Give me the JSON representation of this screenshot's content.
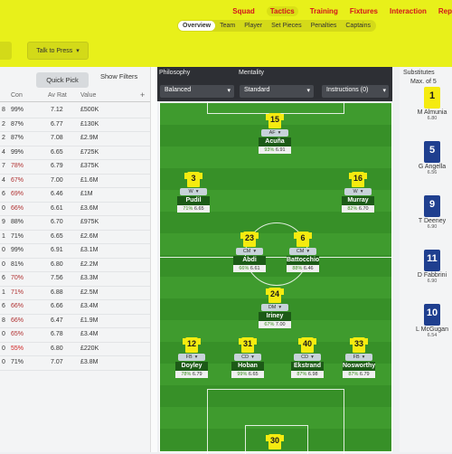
{
  "nav": [
    "Squad",
    "Tactics",
    "Training",
    "Fixtures",
    "Interaction",
    "Rep"
  ],
  "subnav": [
    "Overview",
    "Team",
    "Player",
    "Set Pieces",
    "Penalties",
    "Captains"
  ],
  "talk_button": "Talk to Press",
  "quick_pick": "Quick Pick",
  "show_filters": "Show Filters",
  "table": {
    "headers": {
      "con": "Con",
      "av_rat": "Av Rat",
      "value": "Value",
      "add": "+"
    },
    "rows": [
      {
        "n": "8",
        "con": "99%",
        "rat": "7.12",
        "val": "£500K",
        "con_color": "#333"
      },
      {
        "n": "2",
        "con": "87%",
        "rat": "6.77",
        "val": "£130K",
        "con_color": "#333"
      },
      {
        "n": "2",
        "con": "87%",
        "rat": "7.08",
        "val": "£2.9M",
        "con_color": "#333"
      },
      {
        "n": "4",
        "con": "99%",
        "rat": "6.65",
        "val": "£725K",
        "con_color": "#333"
      },
      {
        "n": "7",
        "con": "78%",
        "rat": "6.79",
        "val": "£375K",
        "con_color": "#b03030"
      },
      {
        "n": "4",
        "con": "67%",
        "rat": "7.00",
        "val": "£1.6M",
        "con_color": "#b03030"
      },
      {
        "n": "6",
        "con": "69%",
        "rat": "6.46",
        "val": "£1M",
        "con_color": "#b03030"
      },
      {
        "n": "0",
        "con": "66%",
        "rat": "6.61",
        "val": "£3.6M",
        "con_color": "#b03030"
      },
      {
        "n": "9",
        "con": "88%",
        "rat": "6.70",
        "val": "£975K",
        "con_color": "#333"
      },
      {
        "n": "1",
        "con": "71%",
        "rat": "6.65",
        "val": "£2.6M",
        "con_color": "#333"
      },
      {
        "n": "0",
        "con": "99%",
        "rat": "6.91",
        "val": "£3.1M",
        "con_color": "#333"
      },
      {
        "n": "0",
        "con": "81%",
        "rat": "6.80",
        "val": "£2.2M",
        "con_color": "#333"
      },
      {
        "n": "6",
        "con": "70%",
        "rat": "7.56",
        "val": "£3.3M",
        "con_color": "#b03030"
      },
      {
        "n": "1",
        "con": "71%",
        "rat": "6.88",
        "val": "£2.5M",
        "con_color": "#b03030"
      },
      {
        "n": "6",
        "con": "66%",
        "rat": "6.66",
        "val": "£3.4M",
        "con_color": "#b03030"
      },
      {
        "n": "8",
        "con": "66%",
        "rat": "6.47",
        "val": "£1.9M",
        "con_color": "#b03030"
      },
      {
        "n": "0",
        "con": "65%",
        "rat": "6.78",
        "val": "£3.4M",
        "con_color": "#b03030"
      },
      {
        "n": "0",
        "con": "55%",
        "rat": "6.80",
        "val": "£220K",
        "con_color": "#d02020"
      },
      {
        "n": "0",
        "con": "71%",
        "rat": "7.07",
        "val": "£3.8M",
        "con_color": "#333"
      }
    ]
  },
  "tactics": {
    "philosophy_label": "Philosophy",
    "mentality_label": "Mentality",
    "philosophy_value": "Balanced",
    "mentality_value": "Standard",
    "instructions": "Instructions (0)"
  },
  "players": [
    {
      "num": "15",
      "pos": "AF",
      "name": "Acuña",
      "cond": "93%",
      "rat": "6.91"
    },
    {
      "num": "3",
      "pos": "W",
      "name": "Pudil",
      "cond": "71%",
      "rat": "6.65"
    },
    {
      "num": "16",
      "pos": "W",
      "name": "Murray",
      "cond": "82%",
      "rat": "6.70"
    },
    {
      "num": "23",
      "pos": "CM",
      "name": "Abdi",
      "cond": "66%",
      "rat": "6.61"
    },
    {
      "num": "6",
      "pos": "CM",
      "name": "Battocchio",
      "cond": "88%",
      "rat": "6.46"
    },
    {
      "num": "24",
      "pos": "DM",
      "name": "Iriney",
      "cond": "67%",
      "rat": "7.00"
    },
    {
      "num": "12",
      "pos": "FB",
      "name": "Doyley",
      "cond": "78%",
      "rat": "6.79"
    },
    {
      "num": "31",
      "pos": "CD",
      "name": "Hoban",
      "cond": "99%",
      "rat": "6.65"
    },
    {
      "num": "40",
      "pos": "CD",
      "name": "Ekstrand",
      "cond": "87%",
      "rat": "6.98"
    },
    {
      "num": "33",
      "pos": "FB",
      "name": "Nosworthy",
      "cond": "87%",
      "rat": "6.79"
    },
    {
      "num": "30",
      "pos": "GK",
      "name": "",
      "cond": "",
      "rat": ""
    }
  ],
  "subs": {
    "title": "Substitutes",
    "max": "Max. of 5",
    "list": [
      {
        "num": "1",
        "name": "M Almunia",
        "stat": "6.80",
        "color": "#f5eb10"
      },
      {
        "num": "5",
        "name": "G Angella",
        "stat": "6.56",
        "color": "#1f3f8f"
      },
      {
        "num": "9",
        "name": "T Deeney",
        "stat": "6.90",
        "color": "#1f3f8f"
      },
      {
        "num": "11",
        "name": "D Fabbrini",
        "stat": "6.90",
        "color": "#1f3f8f"
      },
      {
        "num": "10",
        "name": "L McGugan",
        "stat": "6.54",
        "color": "#1f3f8f"
      }
    ]
  },
  "colors": {
    "accent": "#e8f01a",
    "nav_text": "#d2141e",
    "pitch": "#3f9b2e"
  }
}
